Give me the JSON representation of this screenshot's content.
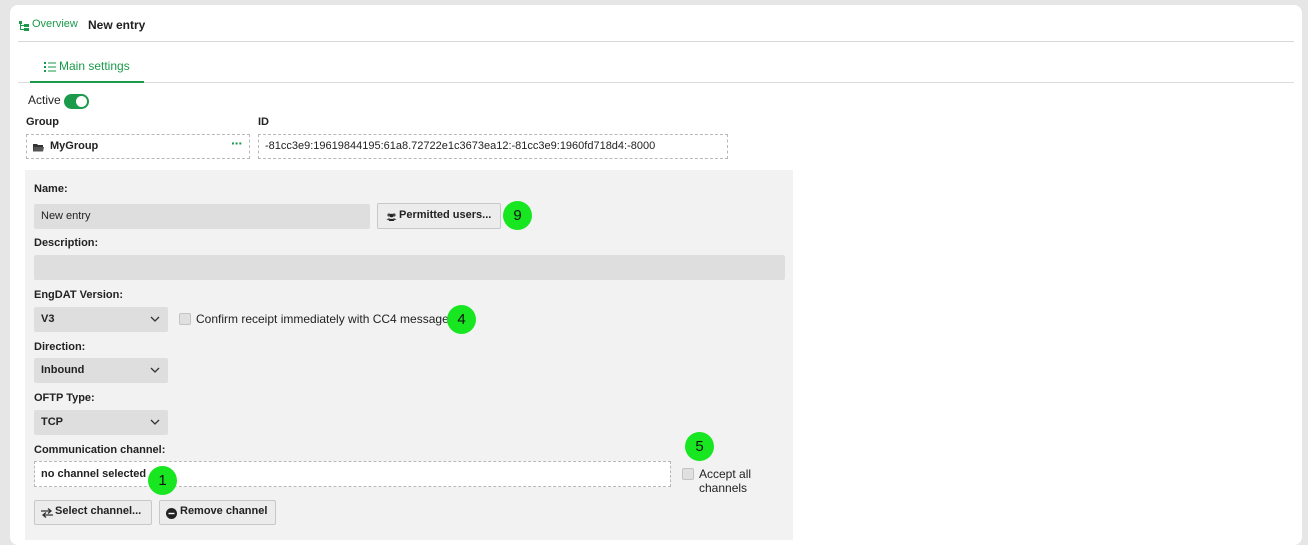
{
  "breadcrumb": {
    "overview": "Overview",
    "current": "New entry"
  },
  "tabs": [
    {
      "label": "Main settings",
      "active": true
    }
  ],
  "active": {
    "label": "Active",
    "on": true
  },
  "group": {
    "label": "Group",
    "value": "MyGroup",
    "more": "···"
  },
  "id": {
    "label": "ID",
    "value": "-81cc3e9:19619844195:61a8.72722e1c3673ea12:-81cc3e9:1960fd718d4:-8000"
  },
  "form": {
    "name_label": "Name:",
    "name_value": "New entry",
    "permitted_users_label": "Permitted users...",
    "description_label": "Description:",
    "description_value": "",
    "engdat_label": "EngDAT Version:",
    "engdat_value": "V3",
    "cc4_label": "Confirm receipt immediately with CC4 message",
    "cc4_checked": false,
    "direction_label": "Direction:",
    "direction_value": "Inbound",
    "oftp_label": "OFTP Type:",
    "oftp_value": "TCP",
    "comm_label": "Communication channel:",
    "comm_value": "no channel selected",
    "accept_all_label": "Accept all channels",
    "accept_all_checked": false,
    "select_channel_label": "Select channel...",
    "remove_channel_label": "Remove channel"
  },
  "markers": {
    "permitted_users": "9",
    "cc4": "4",
    "accept_all": "5",
    "comm_channel": "1"
  },
  "colors": {
    "accent": "#1a9a4a",
    "marker": "#17e620",
    "panel": "#f2f2f2",
    "input_fill": "#dedede"
  }
}
